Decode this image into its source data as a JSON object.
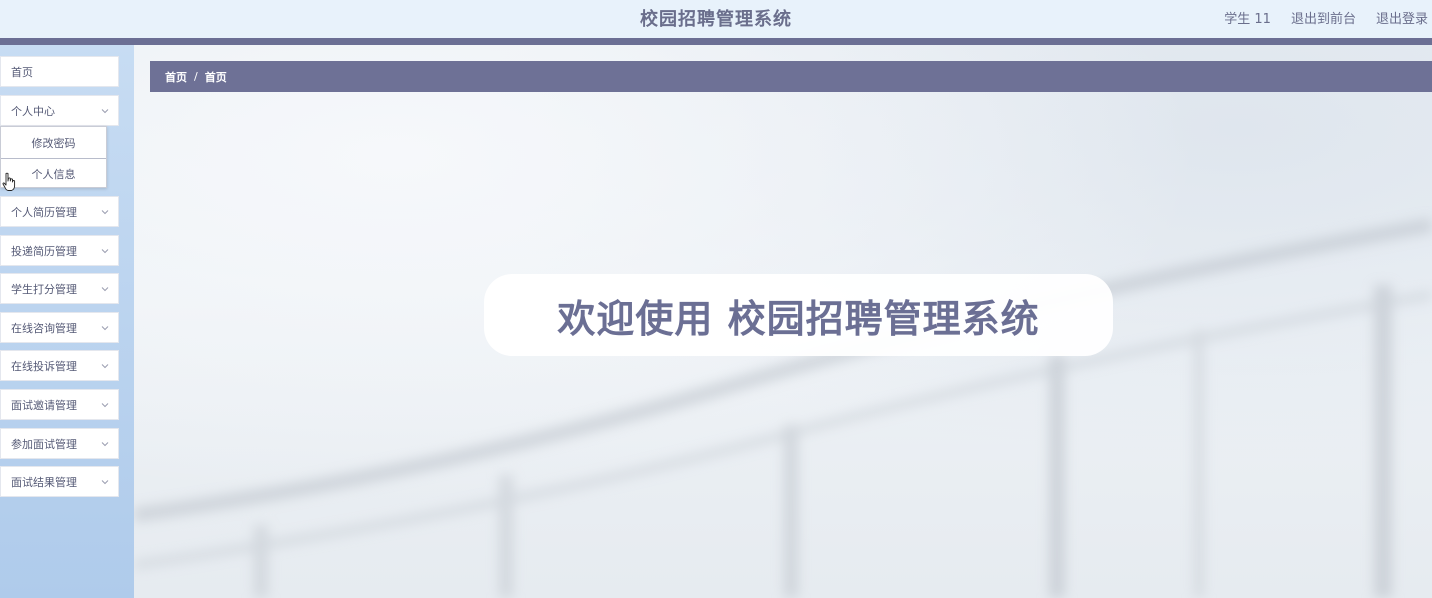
{
  "header": {
    "title": "校园招聘管理系统",
    "user": "学生 11",
    "goto_front": "退出到前台",
    "logout": "退出登录"
  },
  "sidebar": {
    "items": [
      {
        "label": "首页",
        "expandable": false
      },
      {
        "label": "个人中心",
        "expandable": true,
        "expanded": true,
        "children": [
          "修改密码",
          "个人信息"
        ]
      },
      {
        "label": "个人简历管理",
        "expandable": true
      },
      {
        "label": "投递简历管理",
        "expandable": true
      },
      {
        "label": "学生打分管理",
        "expandable": true
      },
      {
        "label": "在线咨询管理",
        "expandable": true
      },
      {
        "label": "在线投诉管理",
        "expandable": true
      },
      {
        "label": "面试邀请管理",
        "expandable": true
      },
      {
        "label": "参加面试管理",
        "expandable": true
      },
      {
        "label": "面试结果管理",
        "expandable": true
      }
    ]
  },
  "breadcrumb": [
    "首页",
    "首页"
  ],
  "breadcrumb_separator": "/",
  "welcome_text": "欢迎使用 校园招聘管理系统",
  "colors": {
    "accent": "#6b6f94",
    "header_bg": "#e8f2fb",
    "sidebar_bg": "#b9d2ee",
    "breadcrumb_bg": "#6e7196"
  },
  "icons": {
    "chevron": "chevron-down-icon",
    "cursor": "hand-pointer-icon"
  }
}
